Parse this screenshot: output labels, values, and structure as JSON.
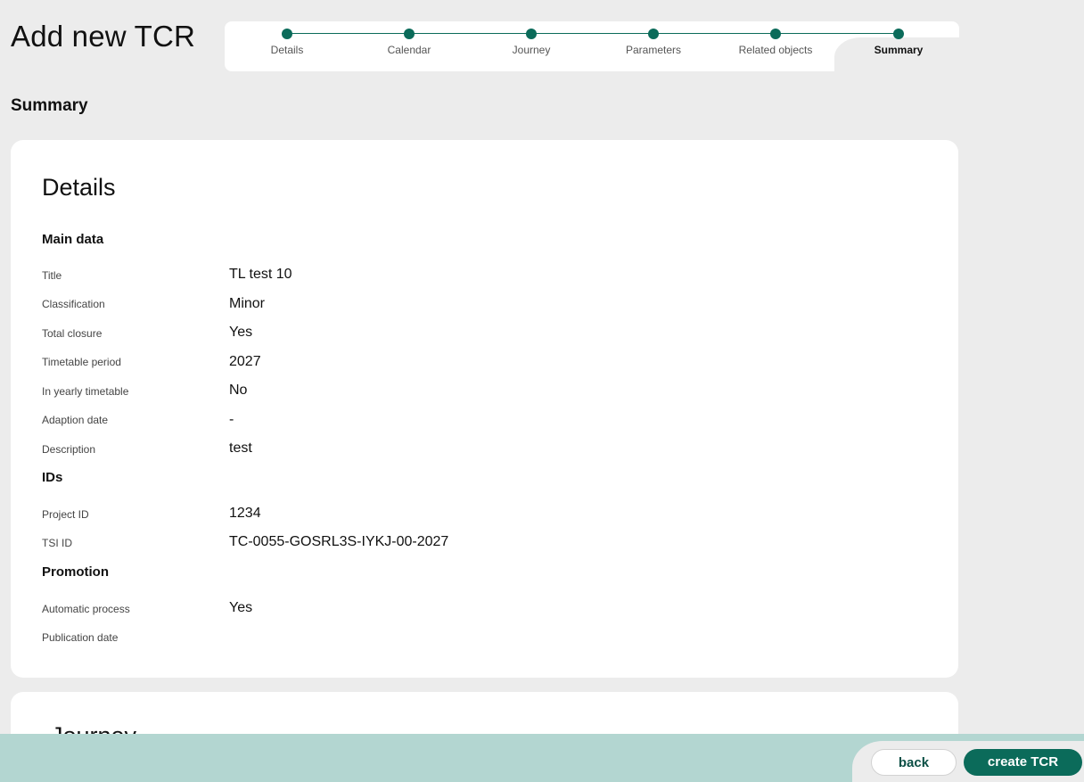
{
  "page": {
    "title": "Add new TCR",
    "section_heading": "Summary"
  },
  "stepper": {
    "steps": [
      {
        "label": "Details"
      },
      {
        "label": "Calendar"
      },
      {
        "label": "Journey"
      },
      {
        "label": "Parameters"
      },
      {
        "label": "Related objects"
      },
      {
        "label": "Summary",
        "active": true
      }
    ]
  },
  "details_card": {
    "title": "Details",
    "main_data": {
      "heading": "Main data",
      "rows": [
        {
          "label": "Title",
          "value": "TL test 10"
        },
        {
          "label": "Classification",
          "value": "Minor"
        },
        {
          "label": "Total closure",
          "value": "Yes"
        },
        {
          "label": "Timetable period",
          "value": "2027"
        },
        {
          "label": "In yearly timetable",
          "value": "No"
        },
        {
          "label": "Adaption date",
          "value": "-"
        },
        {
          "label": "Description",
          "value": "test"
        }
      ]
    },
    "ids": {
      "heading": "IDs",
      "rows": [
        {
          "label": "Project ID",
          "value": "1234"
        },
        {
          "label": "TSI ID",
          "value": "TC-0055-GOSRL3S-IYKJ-00-2027"
        }
      ]
    },
    "promotion": {
      "heading": "Promotion",
      "rows": [
        {
          "label": "Automatic process",
          "value": "Yes"
        },
        {
          "label": "Publication date",
          "value": ""
        }
      ]
    }
  },
  "journey_card": {
    "title": "Journey"
  },
  "footer": {
    "back_label": "back",
    "create_label": "create TCR"
  },
  "colors": {
    "accent": "#0b6b5a",
    "footer_bg": "#b3d6d1",
    "page_bg": "#ececec"
  }
}
